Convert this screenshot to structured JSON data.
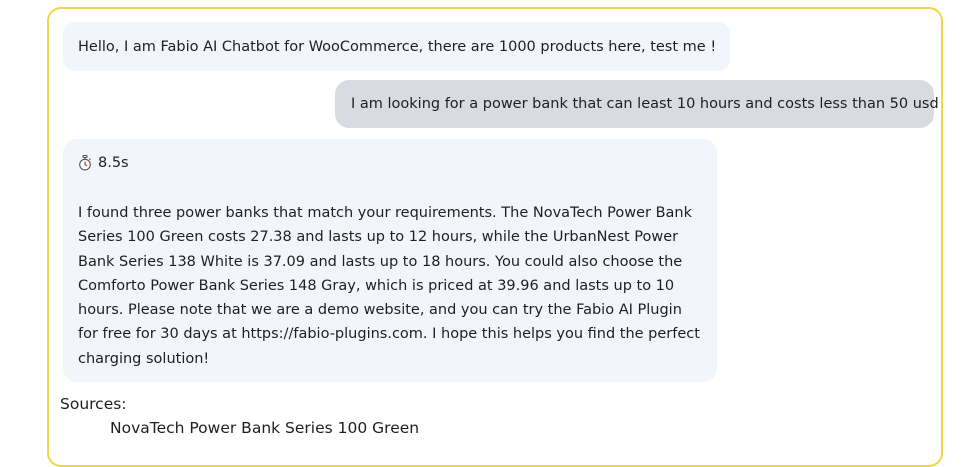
{
  "chat": {
    "greeting": "Hello, I am Fabio AI Chatbot for WooCommerce, there are 1000 products here, test me !",
    "user_message": "I am looking for a power bank that can least 10 hours and costs less than 50 usd",
    "response_time": "8.5s",
    "timer_icon": "stopwatch-icon",
    "answer_paragraph": "I found three power banks that match your requirements. The NovaTech Power Bank Series 100 Green costs 27.38 and lasts up to 12 hours, while the UrbanNest Power Bank Series 138 White is 37.09 and lasts up to 18 hours. You could also choose the Comforto Power Bank Series 148 Gray, which is priced at 39.96 and lasts up to 10 hours. Please note that we are a demo website, and you can try the Fabio AI Plugin for free for 30 days at https://fabio-plugins.com. I hope this helps you find the perfect charging solution!",
    "sources_label": "Sources:",
    "sources": [
      "NovaTech Power Bank Series 100 Green"
    ]
  },
  "colors": {
    "frame_border": "#ecd84a",
    "bot_bubble": "#f3f5fc",
    "user_bubble": "#d9dbe2"
  }
}
